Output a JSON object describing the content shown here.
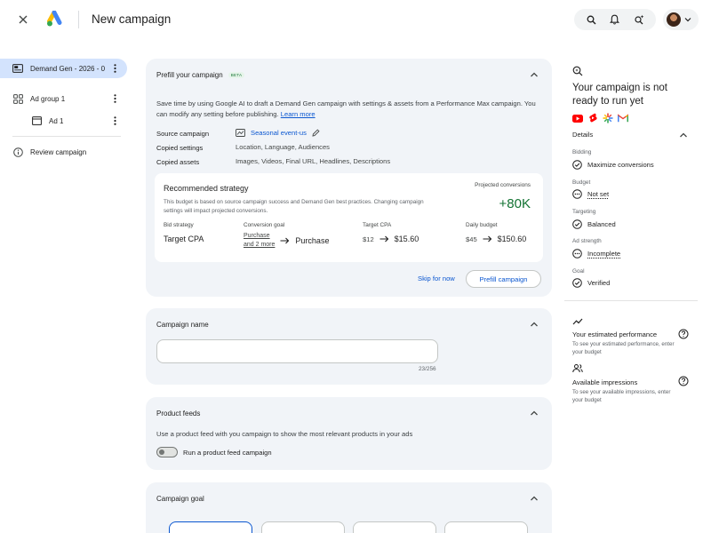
{
  "header": {
    "title": "New campaign",
    "icons": [
      "close-icon",
      "google-ads-logo",
      "search-icon",
      "notifications-icon",
      "ai-search-icon",
      "avatar",
      "chevron-down-icon"
    ]
  },
  "sidebar": {
    "items": [
      {
        "label": "Demand Gen - 2026 - 0",
        "icon": "campaign-icon",
        "active": true
      },
      {
        "label": "Ad group 1",
        "icon": "ad-group-icon"
      },
      {
        "label": "Ad 1",
        "icon": "ad-icon"
      },
      {
        "label": "Review campaign",
        "icon": "info-icon"
      }
    ]
  },
  "prefill": {
    "title": "Prefill your campaign",
    "badge": "BETA",
    "description": "Save time by using Google AI to draft a Demand Gen campaign with settings & assets from a Performance Max campaign. You can modify any setting before publishing.",
    "learn_more": "Learn more",
    "source_label": "Source campaign",
    "source_value": "Seasonal event-us",
    "settings_label": "Copied settings",
    "settings_value": "Location, Language, Audiences",
    "assets_label": "Copied assets",
    "assets_value": "Images, Videos, Final URL, Headlines, Descriptions",
    "strategy": {
      "title": "Recommended strategy",
      "description": "This budget is based on source campaign success and Demand Gen best practices. Changing campaign settings will impact projected conversions.",
      "projected_label": "Projected conversions",
      "projected_value": "+80K",
      "bid_label": "Bid strategy",
      "bid_value": "Target CPA",
      "goal_label": "Conversion goal",
      "goal_from_1": "Purchase",
      "goal_from_2": "and 2 more",
      "goal_to": "Purchase",
      "cpa_label": "Target CPA",
      "cpa_from": "$12",
      "cpa_to": "$15.60",
      "budget_label": "Daily budget",
      "budget_from": "$45",
      "budget_to": "$150.60"
    },
    "skip_label": "Skip for now",
    "prefill_label": "Prefill campaign"
  },
  "campaign_name": {
    "title": "Campaign name",
    "value": "",
    "counter": "23/256"
  },
  "product_feeds": {
    "title": "Product feeds",
    "description": "Use a product feed with you campaign to show the most relevant products in your ads",
    "toggle_label": "Run a product feed campaign",
    "toggle_on": false
  },
  "campaign_goal": {
    "title": "Campaign goal"
  },
  "status": {
    "title": "Your campaign is not ready to run yet",
    "products": [
      "youtube-icon",
      "shorts-icon",
      "discover-icon",
      "gmail-icon"
    ],
    "details_label": "Details",
    "items": [
      {
        "label": "Bidding",
        "value": "Maximize conversions",
        "state": "done"
      },
      {
        "label": "Budget",
        "value": "Not set",
        "state": "pending"
      },
      {
        "label": "Targeting",
        "value": "Balanced",
        "state": "done"
      },
      {
        "label": "Ad strength",
        "value": "Incomplete",
        "state": "pending"
      },
      {
        "label": "Goal",
        "value": "Verified",
        "state": "done"
      }
    ]
  },
  "performance": {
    "title": "Your estimated performance",
    "subtitle": "To see your estimated performance, enter your budget"
  },
  "impressions": {
    "title": "Available impressions",
    "subtitle": "To see your available impressions, enter your budget"
  },
  "colors": {
    "accent": "#0b57d0",
    "active_nav": "#d3e3fd",
    "panel_bg": "#f1f4f8",
    "positive": "#137333"
  }
}
